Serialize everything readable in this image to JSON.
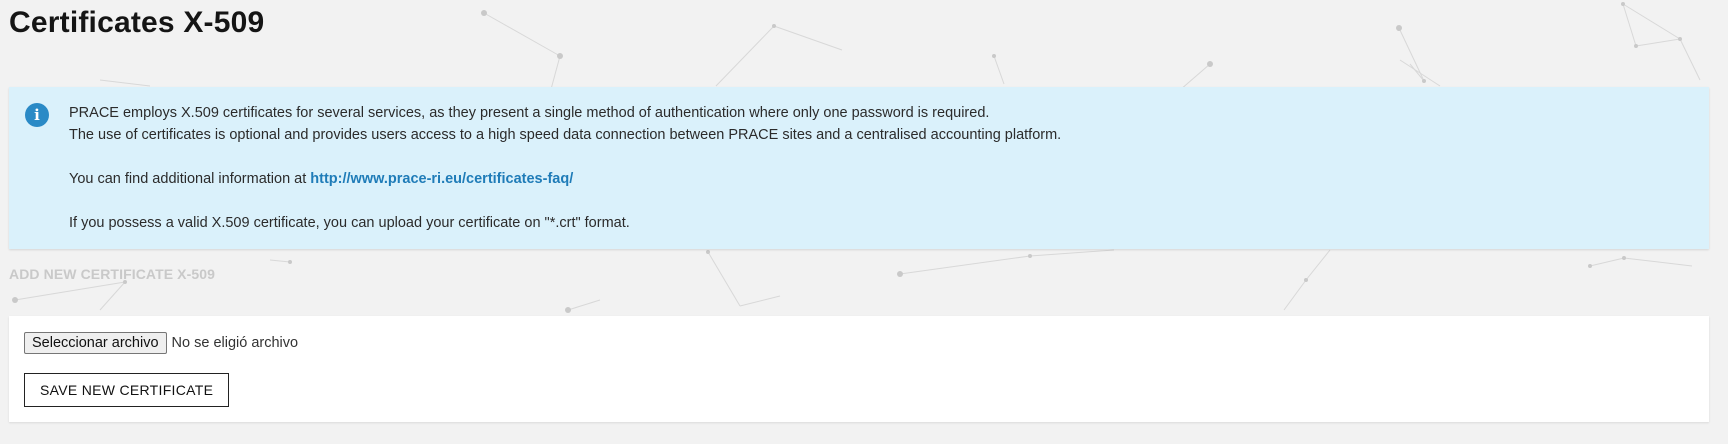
{
  "page": {
    "title": "Certificates X-509"
  },
  "info": {
    "icon": "info-icon",
    "icon_glyph": "i",
    "icon_color": "#2a8ac6",
    "background_color": "#daf1fb",
    "line1": "PRACE employs X.509 certificates for several services, as they present a single method of authentication where only one password is required.",
    "line2": "The use of certificates is optional and provides users access to a high speed data connection between PRACE sites and a centralised accounting platform.",
    "line3_prefix": "You can find additional information at ",
    "link_text": "http://www.prace-ri.eu/certificates-faq/",
    "link_color": "#1f7cb8",
    "line4": "If you possess a valid X.509 certificate, you can upload your certificate on \"*.crt\" format."
  },
  "section": {
    "heading": "ADD NEW CERTIFICATE X-509"
  },
  "upload": {
    "file_button_label": "Seleccionar archivo",
    "file_status": "No se eligió archivo",
    "save_label": "SAVE NEW CERTIFICATE"
  }
}
